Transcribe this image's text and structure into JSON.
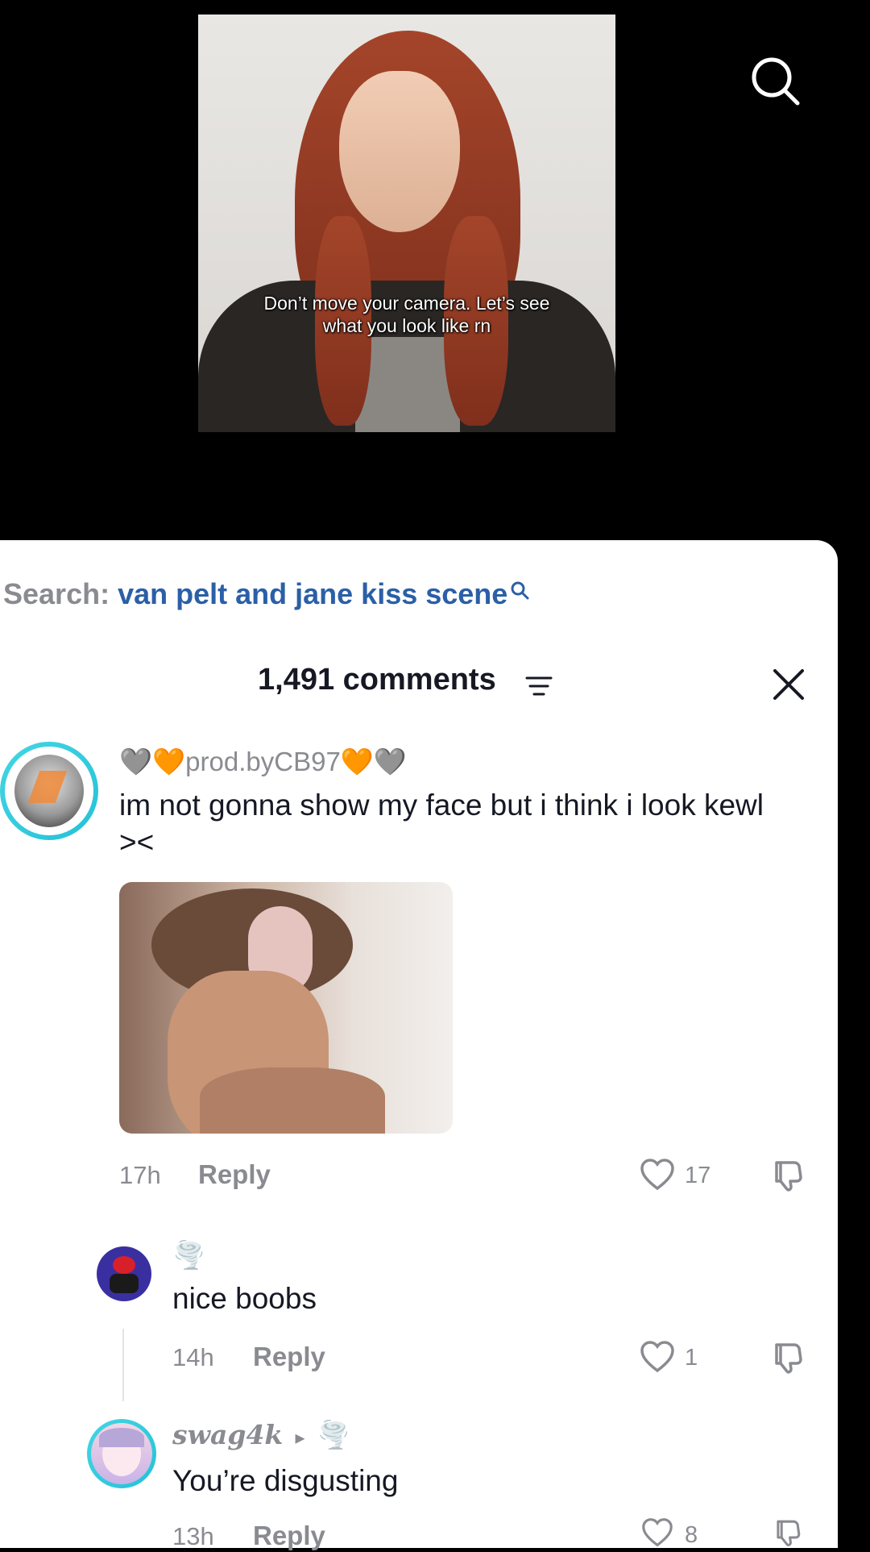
{
  "video": {
    "caption": "Don’t move your camera. Let’s see what you look like rn"
  },
  "search": {
    "prefix": "Search:",
    "query": "van pelt and jane kiss scene"
  },
  "comments_header": {
    "title": "1,491 comments"
  },
  "comments": [
    {
      "username": "🩶🧡prod.byCB97🧡🩶",
      "text": "im not gonna show my face but i think i look kewl ><",
      "time": "17h",
      "reply_label": "Reply",
      "likes": "17"
    },
    {
      "username": "🌪️",
      "text": "nice boobs",
      "time": "14h",
      "reply_label": "Reply",
      "likes": "1"
    },
    {
      "username": "swag4k",
      "reply_arrow": "▸",
      "reply_to": "🌪️",
      "text": "You’re disgusting",
      "time": "13h",
      "reply_label": "Reply",
      "likes": "8"
    }
  ],
  "colors": {
    "search_query": "#2b5fa7",
    "muted": "#8a8b91",
    "ring": "#25c1d8"
  },
  "icons": [
    "search-icon",
    "filter-icon",
    "close-icon",
    "heart-icon",
    "dislike-icon",
    "play-arrow-icon"
  ]
}
